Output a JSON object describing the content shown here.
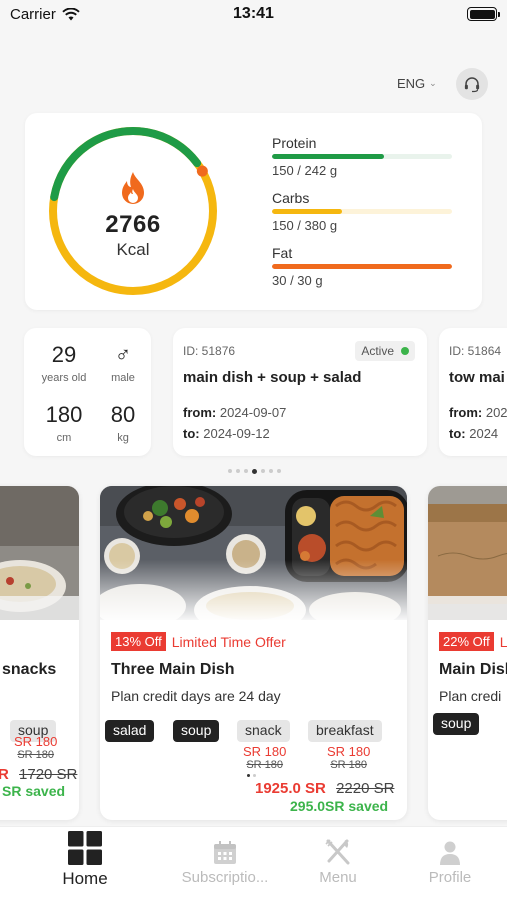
{
  "status_bar": {
    "carrier": "Carrier",
    "time": "13:41"
  },
  "header": {
    "language": "ENG",
    "support_icon": "headset-icon"
  },
  "calories": {
    "value": "2766",
    "unit": "Kcal",
    "progress": 0.72,
    "macros": [
      {
        "name": "Protein",
        "amount": "150 / 242 g",
        "fraction": 0.62,
        "color": "#1f9b46",
        "track": "#e9f3ec"
      },
      {
        "name": "Carbs",
        "amount": "150 / 380 g",
        "fraction": 0.39,
        "color": "#f5b70f",
        "track": "#fdf3d9"
      },
      {
        "name": "Fat",
        "amount": "30 / 30 g",
        "fraction": 1.0,
        "color": "#f06a1d",
        "track": "#fde6d8"
      }
    ]
  },
  "profile": {
    "age": "29",
    "age_label": "years old",
    "gender_label": "male",
    "height": "180",
    "height_unit": "cm",
    "weight": "80",
    "weight_unit": "kg"
  },
  "subscriptions": [
    {
      "id": "ID: 51876",
      "status": "Active",
      "title": "main dish + soup + salad",
      "from_label": "from:",
      "from": "2024-09-07",
      "to_label": "to:",
      "to": "2024-09-12"
    },
    {
      "id": "ID: 51864",
      "title": "tow mai",
      "from_label": "from:",
      "from": "2024",
      "to_label": "to:",
      "to": "2024"
    }
  ],
  "plans": [
    {
      "name": "snacks",
      "chips": [
        {
          "label": "soup",
          "price": "SR 180",
          "old": "SR 180"
        }
      ],
      "total_new": "R",
      "total_old": "1720 SR",
      "saved": "SR saved"
    },
    {
      "offer_pct": "13% Off",
      "offer_text": "Limited Time Offer",
      "name": "Three Main Dish",
      "credit": "Plan credit days are 24 day",
      "chips": [
        {
          "label": "salad",
          "style": "dark"
        },
        {
          "label": "soup",
          "style": "dark"
        },
        {
          "label": "snack",
          "style": "light",
          "price": "SR 180",
          "old": "SR 180"
        },
        {
          "label": "breakfast",
          "style": "light",
          "price": "SR 180",
          "old": "SR 180"
        }
      ],
      "total_new": "1925.0 SR",
      "total_old": "2220 SR",
      "saved": "295.0SR saved"
    },
    {
      "offer_pct": "22% Off",
      "offer_text": "L",
      "name": "Main Dish",
      "credit": "Plan credi",
      "chips": [
        {
          "label": "soup",
          "style": "dark"
        }
      ]
    }
  ],
  "nav": [
    {
      "label": "Home",
      "icon": "grid-icon",
      "active": true
    },
    {
      "label": "Subscriptio...",
      "icon": "calendar-icon"
    },
    {
      "label": "Menu",
      "icon": "utensils-icon"
    },
    {
      "label": "Profile",
      "icon": "person-icon"
    }
  ]
}
